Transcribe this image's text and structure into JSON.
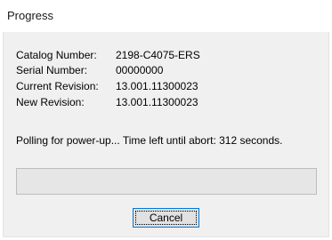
{
  "window": {
    "title": "Progress"
  },
  "info": {
    "catalog_label": "Catalog Number:",
    "catalog_value": "2198-C4075-ERS",
    "serial_label": "Serial Number:",
    "serial_value": "00000000",
    "current_revision_label": "Current Revision:",
    "current_revision_value": "13.001.11300023",
    "new_revision_label": "New Revision:",
    "new_revision_value": "13.001.11300023"
  },
  "status": {
    "message": "Polling for power-up... Time left until abort: 312 seconds."
  },
  "progress": {
    "fraction": 0
  },
  "buttons": {
    "cancel_label": "Cancel"
  },
  "colors": {
    "client_background": "#f0f0f0",
    "button_focus_border": "#0078d7",
    "progress_track": "#e6e6e6",
    "progress_fill": "#06b025"
  }
}
